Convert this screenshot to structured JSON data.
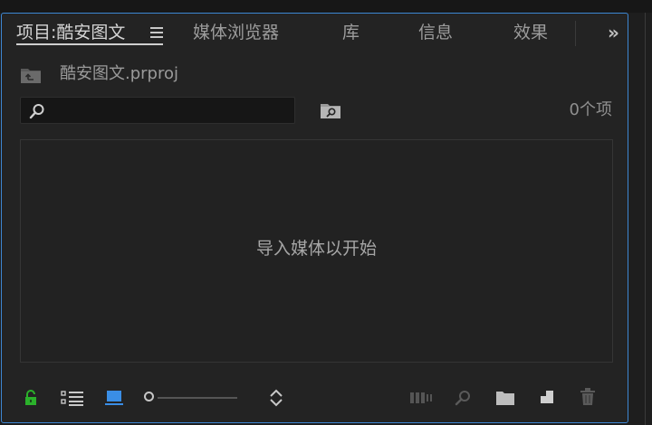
{
  "tabs": {
    "project_tab": "项目:酷安图文",
    "media_browser": "媒体浏览器",
    "library": "库",
    "info": "信息",
    "effects": "效果",
    "overflow_glyph": "»"
  },
  "project": {
    "file_name": "酷安图文.prproj"
  },
  "search": {
    "value": "",
    "placeholder": ""
  },
  "item_count": "0个项",
  "content": {
    "empty_message": "导入媒体以开始"
  },
  "colors": {
    "accent_blue": "#3d87d3",
    "lock_green": "#2bb12b",
    "icon_view_blue": "#3a8ee6"
  },
  "toolbar_icons": [
    "lock-icon",
    "list-view-icon",
    "icon-view-icon",
    "zoom-slider",
    "sort-icon",
    "automate-to-sequence-icon",
    "find-icon",
    "new-bin-icon",
    "new-item-icon",
    "trash-icon"
  ]
}
